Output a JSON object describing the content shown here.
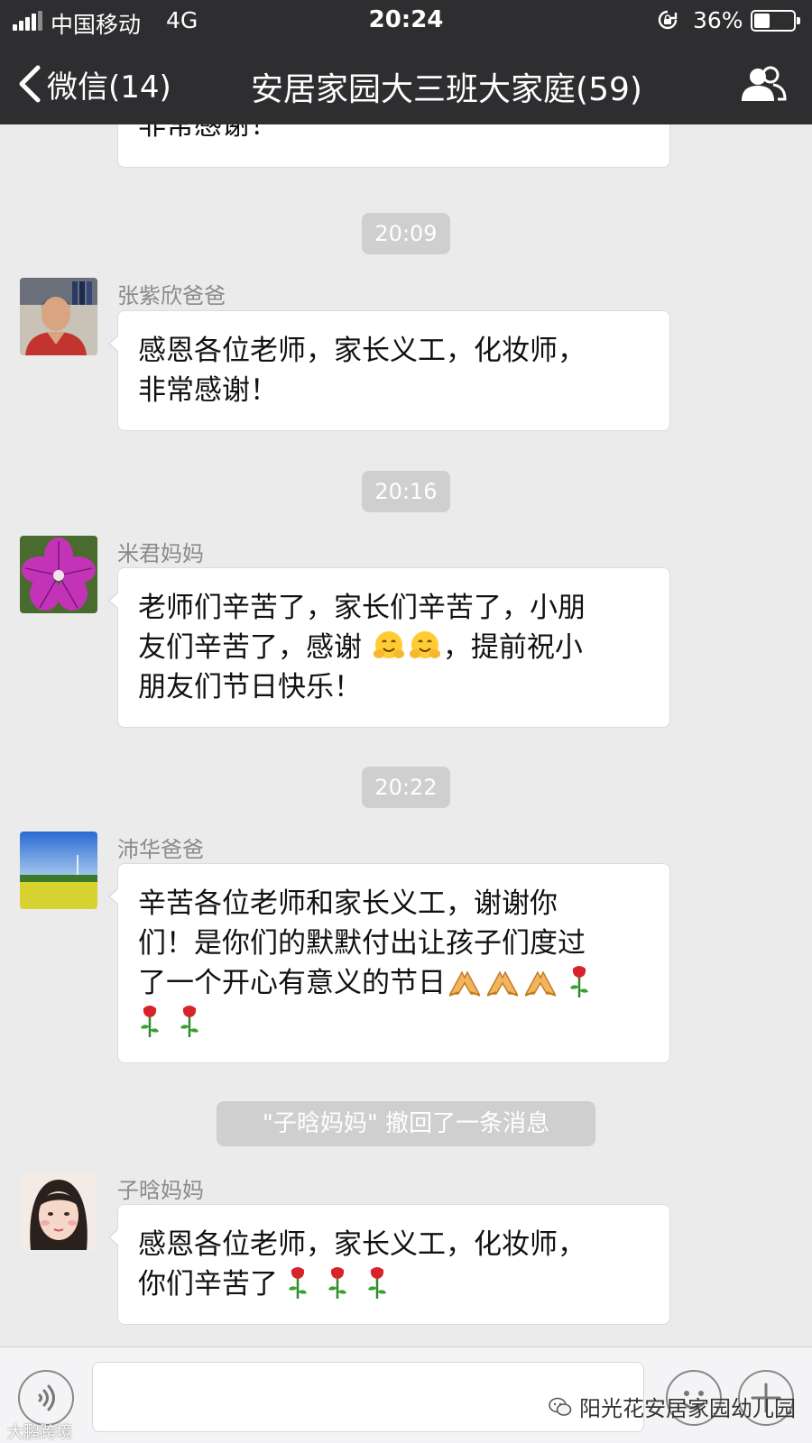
{
  "status_bar": {
    "carrier": "中国移动",
    "network": "4G",
    "time": "20:24",
    "battery": "36%",
    "battery_level": 0.36
  },
  "nav": {
    "back_label": "微信(14)",
    "title": "安居家园大三班大家庭(59)",
    "icons": [
      "chevron-left-icon",
      "members-icon"
    ]
  },
  "chat": {
    "clipped_message": "非常感谢！",
    "time_1": "20:09",
    "message_1": {
      "sender": "张紫欣爸爸",
      "lines": [
        "感恩各位老师，家长义工，化妆师，",
        "非常感谢！"
      ]
    },
    "time_2": "20:16",
    "message_2": {
      "sender": "米君妈妈",
      "line1": "老师们辛苦了，家长们辛苦了，小朋",
      "line2_before": "友们辛苦了，感谢",
      "line2_after": "，提前祝小",
      "line3": "朋友们节日快乐！",
      "emoji": "hugging-face-icon"
    },
    "time_3": "20:22",
    "message_3": {
      "sender": "沛华爸爸",
      "line1": "辛苦各位老师和家长义工，谢谢你",
      "line2": "们！是你们的默默付出让孩子们度过",
      "line3": "了一个开心有意义的节日",
      "emojis": [
        "folded-hands-icon",
        "rose-icon"
      ]
    },
    "recall_notice": "\"子晗妈妈\" 撤回了一条消息",
    "message_4": {
      "sender": "子晗妈妈",
      "line1": "感恩各位老师，家长义工，化妆师，",
      "line2": "你们辛苦了"
    }
  },
  "input_bar": {
    "icons": [
      "voice-icon",
      "emoji-face-icon",
      "plus-icon"
    ],
    "watermark": "阳光花安居家园幼儿园",
    "watermark_small": "大鹏跨境"
  },
  "colors": {
    "topbar": "#2e2e31",
    "chat_background": "#ebebeb",
    "bubble": "#ffffff",
    "time_chip": "#cfcfcf"
  }
}
